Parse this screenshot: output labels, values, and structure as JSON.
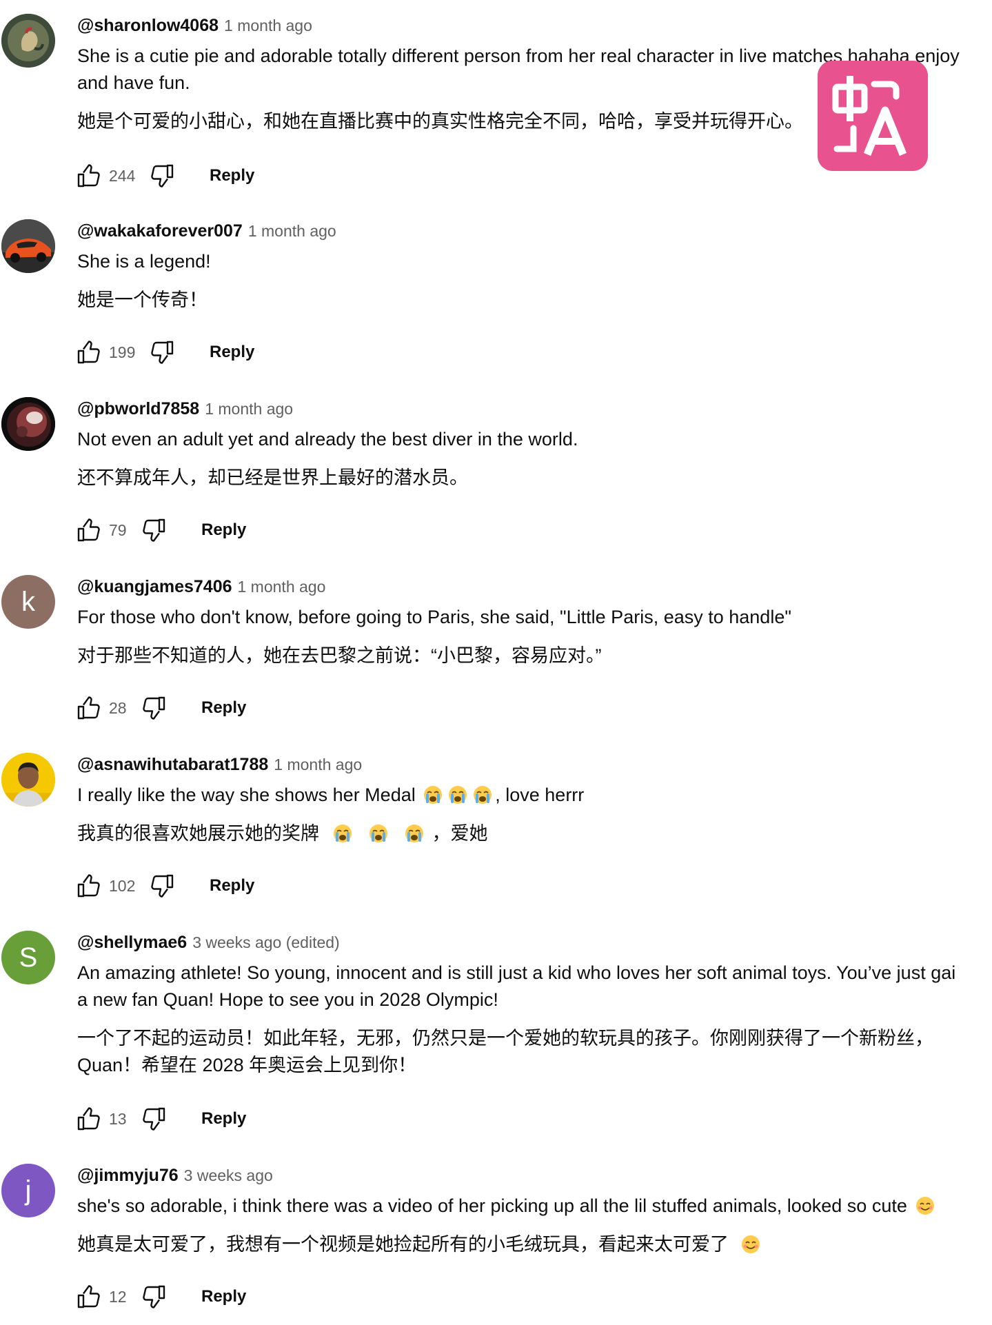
{
  "comments": [
    {
      "handle": "@sharonlow4068",
      "time": "1 month ago",
      "text_en_1": "She is a cutie pie and adorable totally different person from her real character in live matches hahaha enjoy",
      "text_en_2": "and have fun.",
      "text_zh": "她是个可爱的小甜心，和她在直播比赛中的真实性格完全不同，哈哈，享受并玩得开心。",
      "likes": "244",
      "reply_label": "Reply",
      "avatar": "rooster-illustration"
    },
    {
      "handle": "@wakakaforever007",
      "time": "1 month ago",
      "text_en_1": "She is a legend!",
      "text_zh": "她是一个传奇！",
      "likes": "199",
      "reply_label": "Reply",
      "avatar": "orange-sports-car"
    },
    {
      "handle": "@pbworld7858",
      "time": "1 month ago",
      "text_en_1": "Not even an adult yet and already the best diver in the world.",
      "text_zh": "还不算成年人，却已经是世界上最好的潜水员。",
      "likes": "79",
      "reply_label": "Reply",
      "avatar": "dark-red-sphere"
    },
    {
      "handle": "@kuangjames7406",
      "time": "1 month ago",
      "text_en_1": "For those who don't know, before going to Paris, she said, \"Little Paris, easy to handle\"",
      "text_zh": "对于那些不知道的人，她在去巴黎之前说：“小巴黎，容易应对。”",
      "likes": "28",
      "reply_label": "Reply",
      "avatar_letter": "k",
      "avatar_color": "#8d6e63"
    },
    {
      "handle": "@asnawihutabarat1788",
      "time": "1 month ago",
      "text_en_before": "I really like the way she shows her Medal",
      "text_en_after": ", love herrr",
      "text_zh_before": "我真的很喜欢她展示她的奖牌",
      "text_zh_after": "，爱她",
      "emoji": "loudly-crying-face",
      "likes": "102",
      "reply_label": "Reply",
      "avatar": "person-photo-yellow"
    },
    {
      "handle": "@shellymae6",
      "time": "3 weeks ago (edited)",
      "text_en_1": "An amazing  athlete! So young,  innocent and is still just a kid who loves her soft animal toys. You’ve just gai",
      "text_en_2": "a new fan Quan! Hope to see you in 2028 Olympic!",
      "text_zh_1": "一个了不起的运动员！如此年轻，无邪，仍然只是一个爱她的软玩具的孩子。你刚刚获得了一个新粉丝，",
      "text_zh_2": "Quan！希望在 2028 年奥运会上见到你！",
      "likes": "13",
      "reply_label": "Reply",
      "avatar_letter": "S",
      "avatar_color": "#689f38"
    },
    {
      "handle": "@jimmyju76",
      "time": "3 weeks ago",
      "text_en_1": "she's so adorable,  i think there was a video of her picking up all the lil stuffed animals,  looked so cute",
      "text_zh": "她真是太可爱了，我想有一个视频是她捡起所有的小毛绒玩具，看起来太可爱了",
      "emoji": "smiling-face",
      "likes": "12",
      "reply_label": "Reply",
      "avatar_letter": "j",
      "avatar_color": "#7e57c2"
    }
  ],
  "icons": {
    "like": "thumbs-up-icon",
    "dislike": "thumbs-down-icon",
    "translate": "translate-badge-icon"
  },
  "colors": {
    "translate_badge": "#e8528f",
    "secondary_text": "#606060",
    "primary_text": "#0f0f0f"
  }
}
